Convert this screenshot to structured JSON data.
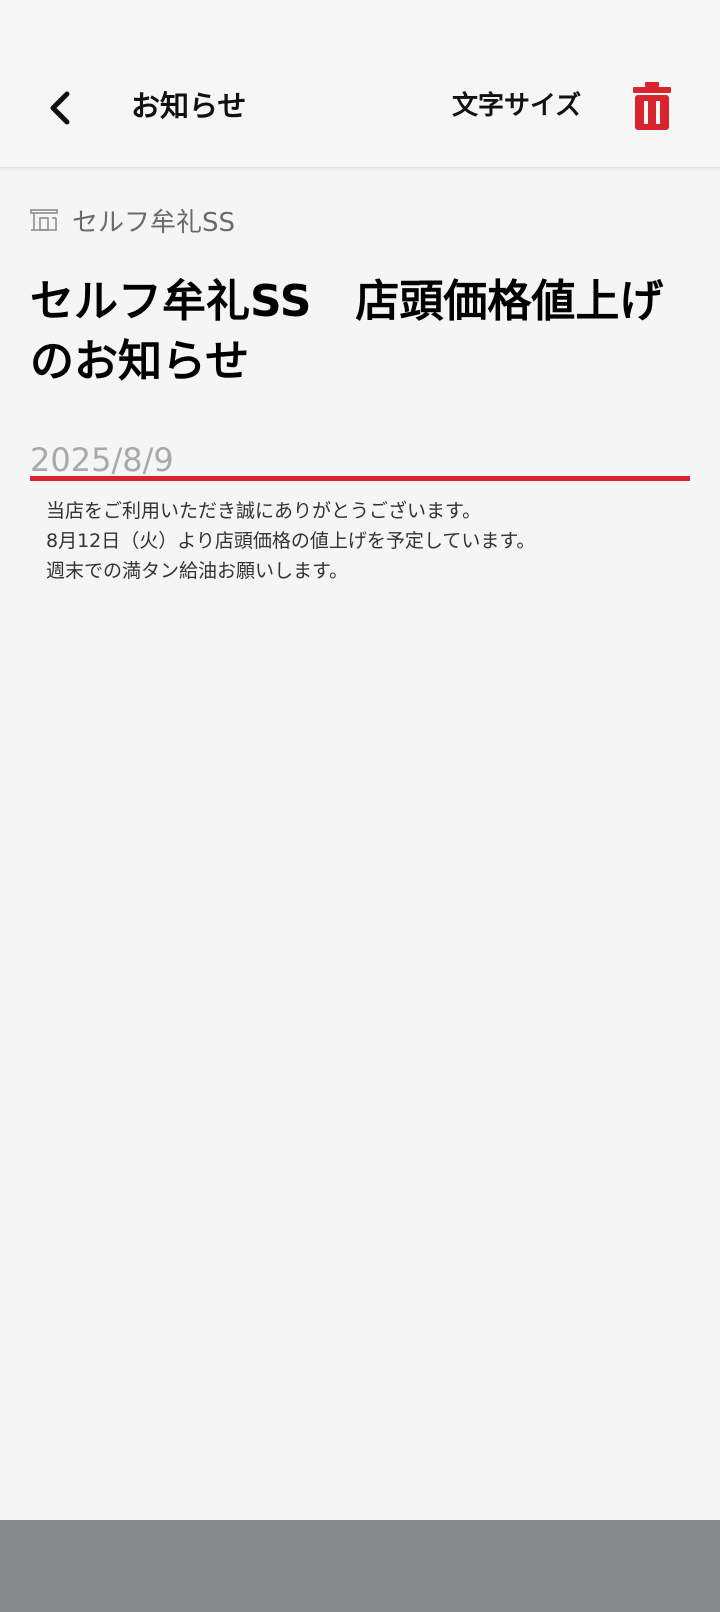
{
  "header": {
    "back_icon": "chevron-left-icon",
    "title": "お知らせ",
    "font_size_label": "文字サイズ",
    "delete_icon": "trash-icon",
    "accent_color": "#d9232d"
  },
  "article": {
    "store_icon": "gas-station-icon",
    "store_name": "セルフ牟礼SS",
    "title": "セルフ牟礼SS　店頭価格値上げ\nのお知らせ",
    "date": "2025/8/9",
    "body": [
      "当店をご利用いただき誠にありがとうございます。",
      "8月12日（火）より店頭価格の値上げを予定しています。",
      "週末での満タン給油お願いします。"
    ]
  }
}
